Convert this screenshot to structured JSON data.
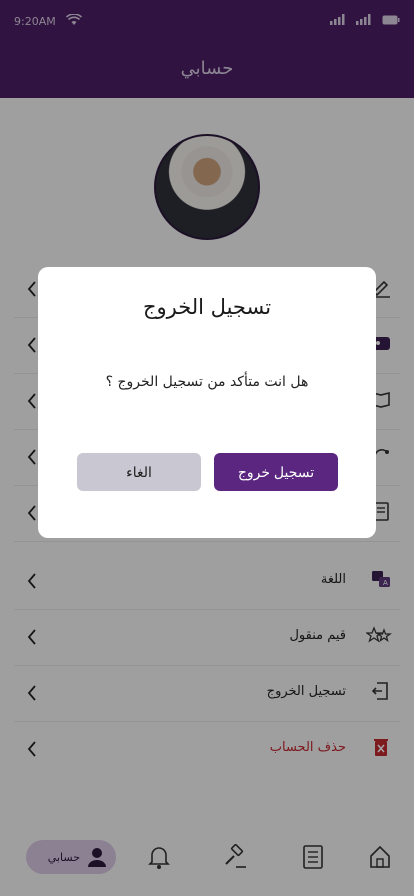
{
  "status_bar": {
    "time": "9:20AM"
  },
  "header": {
    "title": "حسابي"
  },
  "menu": {
    "items": [
      {
        "label": "",
        "icon": "edit-icon"
      },
      {
        "label": "",
        "icon": "id-card-icon"
      },
      {
        "label": "",
        "icon": "book-icon"
      },
      {
        "label": "",
        "icon": "share-icon"
      },
      {
        "label": "",
        "icon": "document-icon"
      },
      {
        "label": "اللغة",
        "icon": "language-icon"
      },
      {
        "label": "قيم منقول",
        "icon": "rate-stars-icon"
      },
      {
        "label": "تسجيل الخروج",
        "icon": "logout-icon"
      },
      {
        "label": "حذف الحساب",
        "icon": "trash-icon",
        "danger": true
      }
    ]
  },
  "bottom_nav": {
    "active_label": "حسابي",
    "items": [
      "profile-icon",
      "bell-icon",
      "gavel-icon",
      "list-icon",
      "home-icon"
    ]
  },
  "dialog": {
    "title": "تسجيل الخروج",
    "message": "هل انت متأكد من تسجيل الخروج ؟",
    "confirm_label": "تسجيل خروج",
    "cancel_label": "الغاء"
  },
  "colors": {
    "header": "#4a1e63",
    "confirm_button": "#5b2680",
    "cancel_button": "#c9c8d2",
    "danger": "#c0282f"
  }
}
